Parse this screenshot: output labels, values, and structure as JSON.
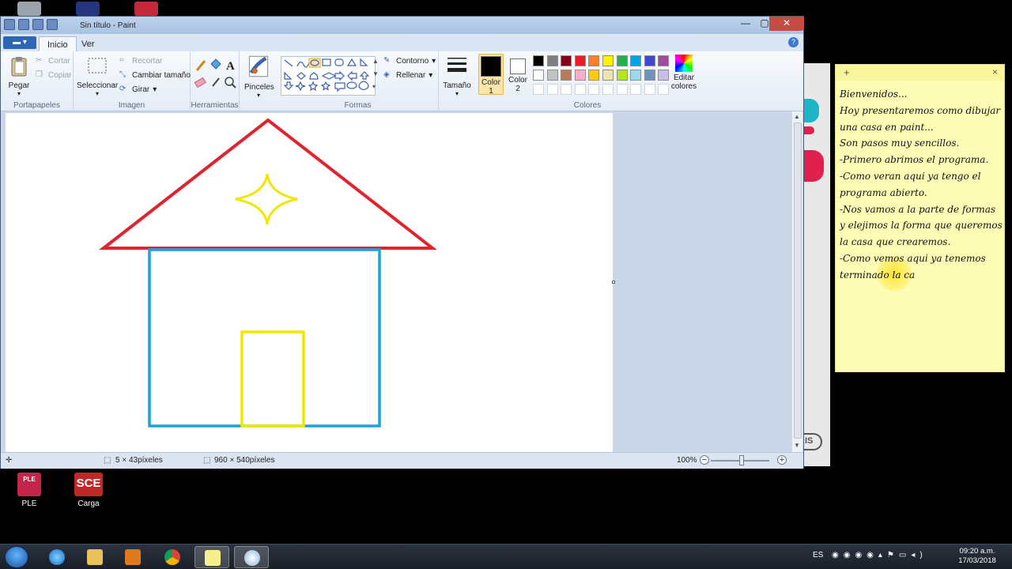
{
  "window": {
    "title": "Sin título - Paint",
    "file_tab": "▬ ▾",
    "tabs": [
      "Inicio",
      "Ver"
    ],
    "help": "?"
  },
  "ribbon": {
    "clipboard": {
      "paste": "Pegar",
      "cut": "Cortar",
      "copy": "Copiar",
      "label": "Portapapeles"
    },
    "image": {
      "select": "Seleccionar",
      "crop": "Recortar",
      "resize": "Cambiar tamaño",
      "rotate": "Girar",
      "label": "Imagen"
    },
    "tools": {
      "label": "Herramientas"
    },
    "brushes": {
      "label": "Pinceles"
    },
    "shapes": {
      "outline": "Contorno",
      "fill": "Rellenar",
      "label": "Formas"
    },
    "size": {
      "label": "Tamaño"
    },
    "colors": {
      "color1": "Color 1",
      "color1_line1": "Color",
      "color1_line2": "1",
      "color2_line1": "Color",
      "color2_line2": "2",
      "edit_line1": "Editar",
      "edit_line2": "colores",
      "label": "Colores",
      "color1_value": "#000000",
      "color2_value": "#ffffff",
      "palette_row1": [
        "#000000",
        "#7f7f7f",
        "#880015",
        "#ed1c24",
        "#ff7f27",
        "#fff200",
        "#22b14c",
        "#00a2e8",
        "#3f48cc",
        "#a349a4"
      ],
      "palette_row2": [
        "#ffffff",
        "#c3c3c3",
        "#b97a57",
        "#ffaec9",
        "#ffc90e",
        "#efe4b0",
        "#b5e61d",
        "#99d9ea",
        "#7092be",
        "#c8bfe7"
      ]
    }
  },
  "drawing": {
    "roof_color": "#e0232e",
    "wall_color": "#1aa3dc",
    "door_color": "#f2e500",
    "star_color": "#f2e500"
  },
  "status": {
    "cursor_pos": "5 × 43píxeles",
    "image_size": "960 × 540píxeles",
    "zoom": "100%",
    "zoom_minus": "−",
    "zoom_plus": "+"
  },
  "sticky": {
    "plus": "+",
    "close": "×",
    "lines": [
      "Bienvenidos...",
      "Hoy presentaremos como dibujar",
      "una casa en paint...",
      "Son pasos muy sencillos.",
      "-Primero abrimos el programa.",
      "-Como veran aqui ya tengo el",
      "programa abierto.",
      "-Nos vamos a la parte de formas",
      "y elejimos la forma que queremos",
      "la casa que  crearemos.",
      "-Como vemos aqui ya tenemos",
      "terminado la ca"
    ]
  },
  "desktop_icons": [
    {
      "label": "PLE",
      "badge": "PLE"
    },
    {
      "label": "Carga",
      "badge": "SCE"
    }
  ],
  "right_app": {
    "pill": "IS"
  },
  "taskbar": {
    "lang": "ES",
    "time": "09:20 a.m.",
    "date": "17/03/2018"
  }
}
